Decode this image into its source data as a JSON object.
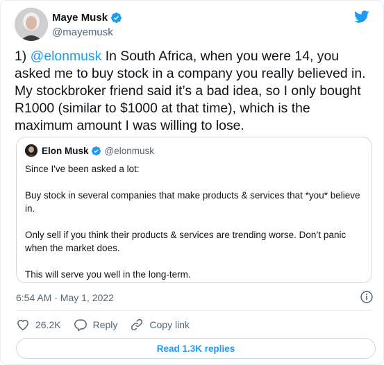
{
  "author": {
    "display_name": "Maye Musk",
    "handle": "@mayemusk"
  },
  "tweet": {
    "number_prefix": "1) ",
    "mention": "@elonmusk",
    "text_after_mention": " In South Africa, when you were 14, you asked me to buy stock in a company you really believed in. My stockbroker friend said it’s a bad idea, so I only bought R1000 (similar to $1000 at that time), which is the maximum amount I was willing to lose."
  },
  "quoted": {
    "display_name": "Elon Musk",
    "handle": "@elonmusk",
    "paragraphs": [
      "Since I've been asked a lot:",
      "Buy stock in several companies that make products & services that *you* believe in.",
      "Only sell if you think their products & services are trending worse. Don’t panic when the market does.",
      "This will serve you well in the long-term."
    ]
  },
  "timestamp": "6:54 AM · May 1, 2022",
  "actions": {
    "like_count": "26.2K",
    "reply_label": "Reply",
    "copy_link_label": "Copy link"
  },
  "read_replies_label": "Read 1.3K replies",
  "colors": {
    "accent": "#1d9bf0",
    "text": "#0f1419",
    "muted": "#536471",
    "border": "#cfd9de"
  },
  "icons": [
    "verified-badge-icon",
    "twitter-bird-icon",
    "info-icon",
    "heart-icon",
    "reply-bubble-icon",
    "link-icon"
  ]
}
